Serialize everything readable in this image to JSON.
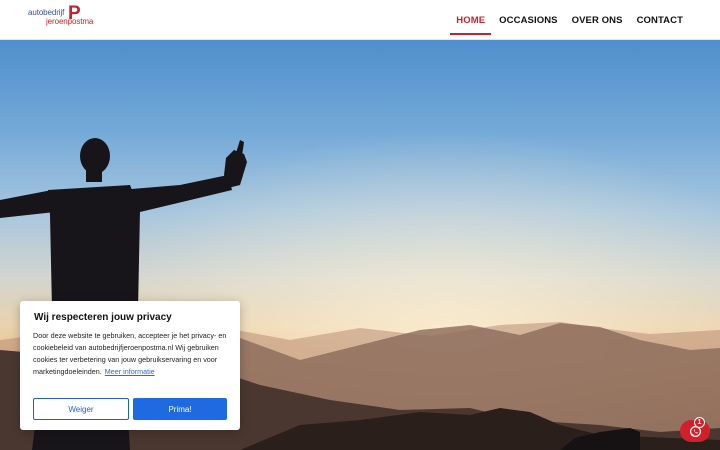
{
  "logo": {
    "line1": "autobedrijf",
    "line2": "jeroenpostma",
    "mark": "P"
  },
  "nav": {
    "items": [
      {
        "label": "HOME",
        "active": true
      },
      {
        "label": "OCCASIONS",
        "active": false
      },
      {
        "label": "OVER ONS",
        "active": false
      },
      {
        "label": "CONTACT",
        "active": false
      }
    ]
  },
  "cookie": {
    "title": "Wij respecteren jouw privacy",
    "body": "Door deze website te gebruiken, accepteer je het privacy- en cookiebeleid van autobedrijfjeroenpostma.nl Wij gebruiken cookies ter verbetering van jouw gebruikservaring en voor marketingdoeleinden.",
    "link": "Meer informatie",
    "decline_label": "Weiger",
    "accept_label": "Prima!"
  },
  "whatsapp": {
    "icon": "whatsapp-icon",
    "badge": "1"
  },
  "colors": {
    "brand_red": "#c8202d",
    "accept_blue": "#1f6ae0"
  }
}
